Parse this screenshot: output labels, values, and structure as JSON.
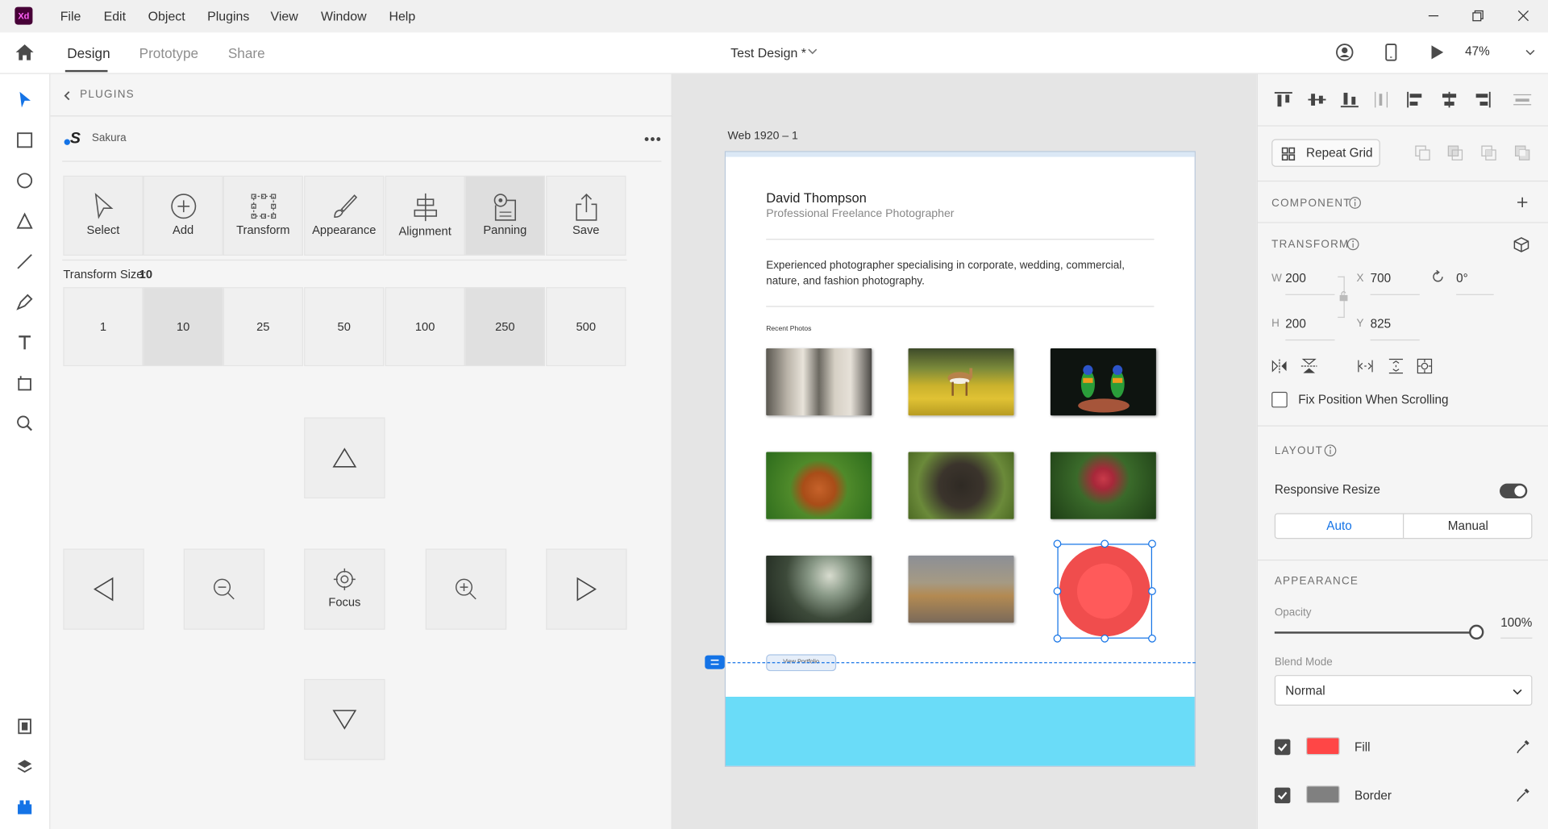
{
  "app": {
    "logo_text": "Xd",
    "menu": [
      "File",
      "Edit",
      "Object",
      "Plugins",
      "View",
      "Window",
      "Help"
    ]
  },
  "toolbar": {
    "tabs": [
      "Design",
      "Prototype",
      "Share"
    ],
    "doc_title": "Test Design *",
    "zoom": "47%"
  },
  "plugins_panel": {
    "back_label": "PLUGINS",
    "plugin_name": "Sakura",
    "tools": [
      "Select",
      "Add",
      "Transform",
      "Appearance",
      "Alignment",
      "Panning",
      "Save"
    ],
    "selected_tool": "Panning",
    "transform_size_label": "Transform Size:",
    "transform_size_value": "10",
    "sizes": [
      "1",
      "10",
      "25",
      "50",
      "100",
      "250",
      "500"
    ],
    "selected_sizes": [
      "10",
      "250"
    ],
    "focus_label": "Focus"
  },
  "artboard": {
    "name": "Web 1920 – 1",
    "person_name": "David Thompson",
    "person_title": "Professional Freelance Photographer",
    "bio": "Experienced photographer specialising in corporate, wedding, commercial, nature, and fashion photography.",
    "recent_label": "Recent Photos",
    "photos": [
      "sheep",
      "springbok",
      "parrots",
      "squirrel",
      "chimpanzee",
      "red-bird",
      "elephant",
      "ducks"
    ],
    "button_label": "View Portfolio",
    "footer_color": "#6adcf8",
    "circle_color": "#f04d4d"
  },
  "right_panel": {
    "repeat_grid": "Repeat Grid",
    "component_head": "COMPONENT",
    "transform_head": "TRANSFORM",
    "w_label": "W",
    "w": "200",
    "x_label": "X",
    "x": "700",
    "rotation": "0°",
    "h_label": "H",
    "h": "200",
    "y_label": "Y",
    "y": "825",
    "fix_position": "Fix Position When Scrolling",
    "layout_head": "LAYOUT",
    "responsive_resize": "Responsive Resize",
    "responsive_on": true,
    "auto_label": "Auto",
    "manual_label": "Manual",
    "appearance_head": "APPEARANCE",
    "opacity_label": "Opacity",
    "opacity_value": "100%",
    "blend_label": "Blend Mode",
    "blend_value": "Normal",
    "fill_label": "Fill",
    "fill_color": "#ff4646",
    "border_label": "Border",
    "border_color": "#808080",
    "accent": "#1473e6"
  }
}
